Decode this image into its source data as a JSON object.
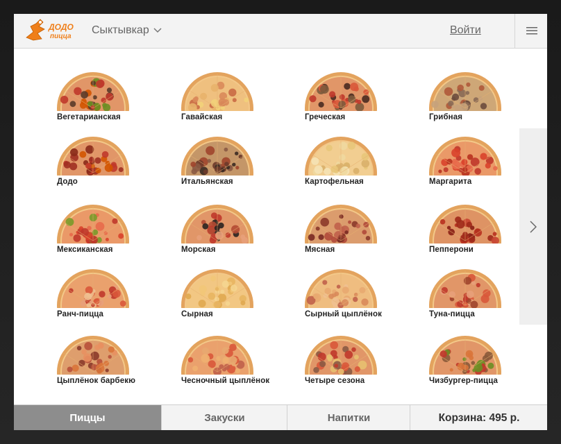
{
  "header": {
    "logo_text_top": "ДОДО",
    "logo_text_bottom": "пицца",
    "city": "Сыктывкар",
    "login_label": "Войти"
  },
  "pizzas": [
    {
      "name": "Вегетарианская",
      "style": "veg"
    },
    {
      "name": "Гавайская",
      "style": "hawaii"
    },
    {
      "name": "Греческая",
      "style": "greek"
    },
    {
      "name": "Грибная",
      "style": "mushroom"
    },
    {
      "name": "Додо",
      "style": "dodo"
    },
    {
      "name": "Итальянская",
      "style": "italian"
    },
    {
      "name": "Картофельная",
      "style": "potato"
    },
    {
      "name": "Маргарита",
      "style": "margarita"
    },
    {
      "name": "Мексиканская",
      "style": "mexican"
    },
    {
      "name": "Морская",
      "style": "sea"
    },
    {
      "name": "Мясная",
      "style": "meat"
    },
    {
      "name": "Пепперони",
      "style": "pepperoni"
    },
    {
      "name": "Ранч-пицца",
      "style": "ranch"
    },
    {
      "name": "Сырная",
      "style": "cheese"
    },
    {
      "name": "Сырный цыплёнок",
      "style": "cheesechicken"
    },
    {
      "name": "Туна-пицца",
      "style": "tuna"
    },
    {
      "name": "Цыплёнок барбекю",
      "style": "bbq"
    },
    {
      "name": "Чесночный цыплёнок",
      "style": "garlic"
    },
    {
      "name": "Четыре сезона",
      "style": "seasons"
    },
    {
      "name": "Чизбургер-пицца",
      "style": "cheeseburger"
    }
  ],
  "tabs": [
    {
      "label": "Пиццы",
      "active": true
    },
    {
      "label": "Закуски",
      "active": false
    },
    {
      "label": "Напитки",
      "active": false
    }
  ],
  "cart": {
    "label": "Корзина: 495 р."
  },
  "colors": {
    "brand_orange": "#ef7f1a",
    "tab_active_bg": "#8d8d8d",
    "header_bg": "#f3f3f3",
    "crust": "#e5a25f"
  },
  "icons": [
    "dodo-logo",
    "chevron-down-icon",
    "hamburger-menu-icon",
    "chevron-right-icon"
  ]
}
